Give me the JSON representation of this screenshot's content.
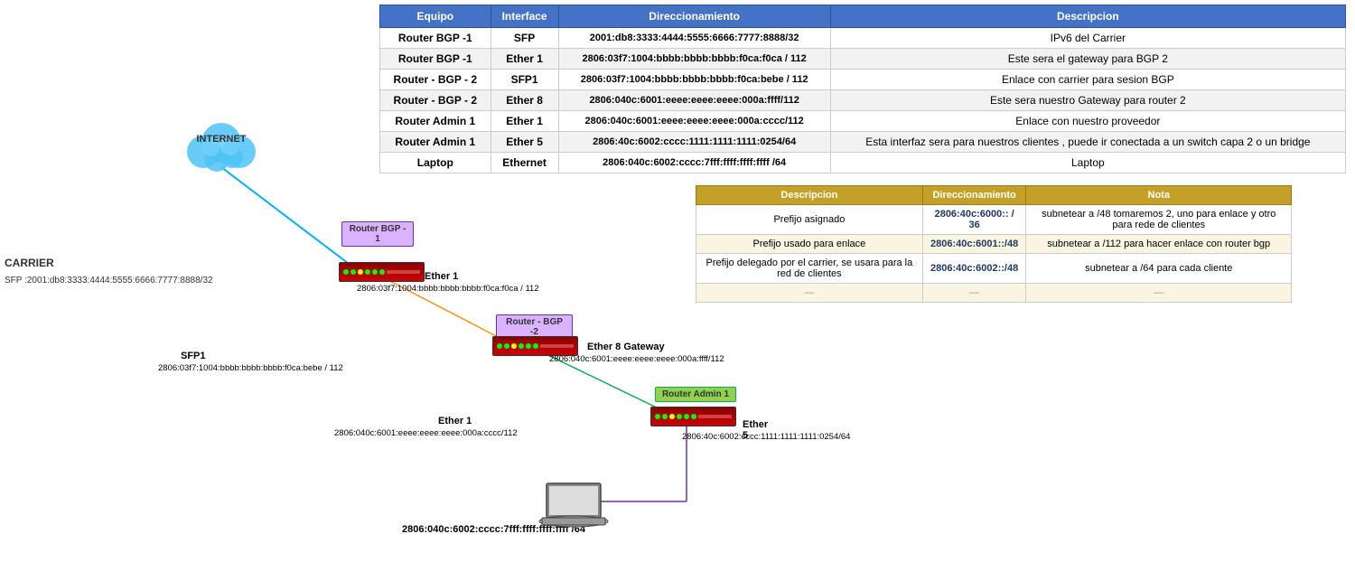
{
  "table": {
    "headers": [
      "Equipo",
      "Interface",
      "Direccionamiento",
      "Descripcion"
    ],
    "rows": [
      [
        "Router BGP -1",
        "SFP",
        "2001:db8:3333:4444:5555:6666:7777:8888/32",
        "IPv6 del Carrier"
      ],
      [
        "Router BGP -1",
        "Ether 1",
        "2806:03f7:1004:bbbb:bbbb:bbbb:f0ca:f0ca / 112",
        "Este sera el gateway para BGP 2"
      ],
      [
        "Router - BGP - 2",
        "SFP1",
        "2806:03f7:1004:bbbb:bbbb:bbbb:f0ca:bebe / 112",
        "Enlace con carrier para sesion BGP"
      ],
      [
        "Router - BGP - 2",
        "Ether 8",
        "2806:040c:6001:eeee:eeee:eeee:000a:ffff/112",
        "Este sera nuestro Gateway para router 2"
      ],
      [
        "Router Admin 1",
        "Ether 1",
        "2806:040c:6001:eeee:eeee:eeee:000a:cccc/112",
        "Enlace con nuestro proveedor"
      ],
      [
        "Router Admin 1",
        "Ether 5",
        "2806:40c:6002:cccc:1111:1111:1111:0254/64",
        "Esta interfaz sera para nuestros clientes , puede ir conectada a un switch capa 2 o un bridge"
      ],
      [
        "Laptop",
        "Ethernet",
        "2806:040c:6002:cccc:7fff:ffff:ffff:ffff /64",
        "Laptop"
      ]
    ]
  },
  "lower_table": {
    "headers": [
      "Descripcion",
      "Direccionamiento",
      "Nota"
    ],
    "rows": [
      [
        "Prefijo asignado",
        "2806:40c:6000:: / 36",
        "subnetear a /48  tomaremos 2, uno para enlace y otro para rede de clientes"
      ],
      [
        "Prefijo usado para enlace",
        "2806:40c:6001::/48",
        "subnetear a /112 para hacer enlace con router bgp"
      ],
      [
        "Prefijo delegado por el carrier, se usara para la red de clientes",
        "2806:40c:6002::/48",
        "subnetear a /64 para cada cliente"
      ],
      [
        "—",
        "—",
        "—"
      ]
    ]
  },
  "diagram": {
    "internet_label": "INTERNET",
    "carrier_label": "CARRIER\nSFP :2001:db8:3333:4444:5555:6666:7777:8888/32",
    "nodes": {
      "router_bgp1_label": "Router BGP -\n1",
      "router_bgp2_label": "Router - BGP -2",
      "router_admin1_label": "Router Admin 1"
    },
    "links": [
      {
        "label": "Ether 1",
        "sublabel": "2806:03f7:1004:bbbb:bbbb:bbbb:f0ca:f0ca / 112"
      },
      {
        "label": "SFP1",
        "sublabel": "2806:03f7:1004:bbbb:bbbb:bbbb:f0ca:bebe / 112"
      },
      {
        "label": "Ether 8 Gateway",
        "sublabel": "2806:040c:6001:eeee:eeee:eeee:000a:ffff/112"
      },
      {
        "label": "Ether 1",
        "sublabel": "2806:040c:6001:eeee:eeee:eeee:000a:cccc/112"
      },
      {
        "label": "Ether 5",
        "sublabel": "2806:40c:6002:cccc:1111:1111:1111:0254/64"
      },
      {
        "label": "",
        "sublabel": "2806:040c:6002:cccc:7fff:ffff:ffff:ffff /64"
      }
    ]
  }
}
